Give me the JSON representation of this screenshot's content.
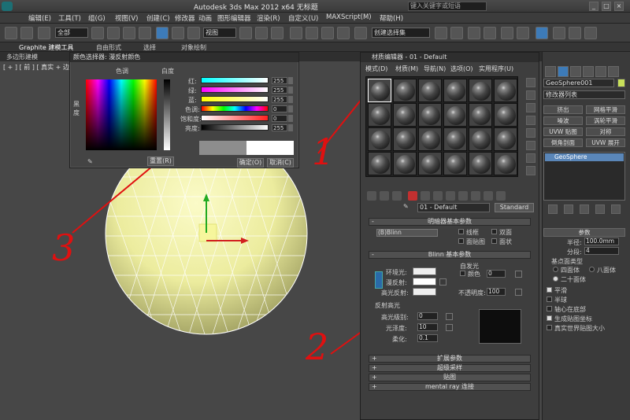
{
  "window": {
    "title": "Autodesk 3ds Max  2012 x64    无标题",
    "search_placeholder": "键入关键字或短语",
    "controls": [
      "_",
      "□",
      "×"
    ]
  },
  "menubar": [
    "编辑(E)",
    "工具(T)",
    "组(G)",
    "视图(V)",
    "创建(C)",
    "修改器",
    "动画",
    "图形编辑器",
    "渲染(R)",
    "自定义(U)",
    "MAXScript(M)",
    "帮助(H)"
  ],
  "toolbar": {
    "selection_filter": "全部",
    "reference_coord": "视图",
    "named_selection": "创建选择集"
  },
  "ribbon": {
    "tabs": [
      "Graphite 建模工具",
      "自由形式",
      "选择",
      "对象绘制"
    ],
    "sub_label": "多边形建模",
    "viewport_label": "[ + ] [ 前 ] [ 真实 + 边面 ]"
  },
  "color_dialog": {
    "title": "颜色选择器: 漫反射颜色",
    "hue_label": "色调",
    "whiteness_label": "白度",
    "blackness_label": "黑度",
    "channels": [
      {
        "label": "红:",
        "value": "255"
      },
      {
        "label": "绿:",
        "value": "255"
      },
      {
        "label": "蓝:",
        "value": "255"
      },
      {
        "label": "色调:",
        "value": "0"
      },
      {
        "label": "饱和度:",
        "value": "0"
      },
      {
        "label": "亮度:",
        "value": "255"
      }
    ],
    "reset_label": "重置(R)",
    "ok_label": "确定(O)",
    "cancel_label": "取消(C)"
  },
  "material_editor": {
    "title": "材质编辑器 - 01 - Default",
    "menu": [
      "模式(D)",
      "材质(M)",
      "导航(N)",
      "选项(O)",
      "实用程序(U)"
    ],
    "material_name": "01 - Default",
    "material_type": "Standard",
    "shader_rollout": "明暗器基本参数",
    "shader_type": "(B)Blinn",
    "shader_options": [
      "线框",
      "双面",
      "面贴图",
      "面状"
    ],
    "blinn_rollout": "Blinn 基本参数",
    "self_illum_label": "自发光",
    "self_illum_color": "颜色",
    "self_illum_value": "0",
    "ambient_label": "环境光:",
    "diffuse_label": "漫反射:",
    "specular_label": "高光反射:",
    "opacity_label": "不透明度:",
    "opacity_value": "100",
    "specular_group": "反射高光",
    "spec_level_label": "高光级别:",
    "spec_level_value": "0",
    "glossiness_label": "光泽度:",
    "glossiness_value": "10",
    "soften_label": "柔化:",
    "soften_value": "0.1",
    "rollouts": [
      "扩展参数",
      "超级采样",
      "贴图",
      "mental ray 连接"
    ]
  },
  "command_panel": {
    "object_name": "GeoSphere001",
    "modifier_list": "修改器列表",
    "buttons": [
      "挤出",
      "网格平滑",
      "噪波",
      "涡轮平滑",
      "UVW 贴图",
      "对称",
      "倒角剖面",
      "UVW 展开"
    ],
    "stack_item": "GeoSphere",
    "params_title": "参数",
    "radius_label": "半径:",
    "radius_value": "100.0mm",
    "segments_label": "分段:",
    "segments_value": "4",
    "base_type_label": "基点面类型",
    "base_types": [
      "四面体",
      "八面体",
      "二十面体"
    ],
    "checks": [
      "平滑",
      "半球",
      "轴心在底部",
      "生成贴图坐标",
      "真实世界贴图大小"
    ]
  },
  "annotations": [
    "1",
    "2",
    "3"
  ],
  "colors": {
    "annotation": "#e01010",
    "object_color": "#c8e05a",
    "sphere": "#f4f4b4"
  }
}
